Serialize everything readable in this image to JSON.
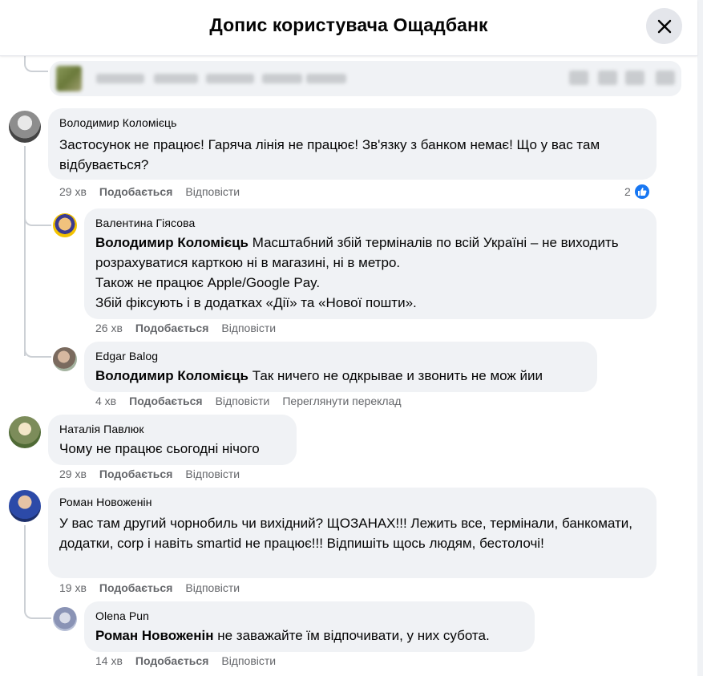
{
  "header": {
    "title": "Допис користувача Ощадбанк"
  },
  "comments": [
    {
      "author": "Володимир Коломієць",
      "text": "Застосунок не працює! Гаряча лінія не працює! Зв'язку з банком немає! Що у вас там відбувається?",
      "time": "29 хв",
      "like_label": "Подобається",
      "reply_label": "Відповісти",
      "reaction_count": "2"
    },
    {
      "author": "Валентина Гіясова",
      "mention": "Володимир Коломієць",
      "text": "Масштабний збій терміналів по всій Україні – не виходить розрахуватися карткою ні в магазині, ні в метро.",
      "line2": "Також не працює Apple/Google Pay.",
      "line3": "Збій фіксують і в додатках «Дії» та «Нової пошти».",
      "time": "26 хв",
      "like_label": "Подобається",
      "reply_label": "Відповісти"
    },
    {
      "author": "Edgar Balog",
      "mention": "Володимир Коломієць",
      "text": "Так ничего не одкрывае и звонить не мож йии",
      "time": "4 хв",
      "like_label": "Подобається",
      "reply_label": "Відповісти",
      "translate_label": "Переглянути переклад"
    },
    {
      "author": "Наталія Павлюк",
      "text": "Чому не працює сьогодні нічого",
      "time": "29 хв",
      "like_label": "Подобається",
      "reply_label": "Відповісти"
    },
    {
      "author": "Роман Новоженін",
      "text": "У вас там другий чорнобиль чи вихідний? ЩОЗАНАХ!!! Лежить все, термінали, банкомати, додатки, corp і навіть smartid не працює!!! Відпишіть щось людям, бестолочі!",
      "time": "19 хв",
      "like_label": "Подобається",
      "reply_label": "Відповісти"
    },
    {
      "author": "Olena Pun",
      "mention": "Роман Новоженін",
      "text": "не заважайте їм відпочивати, у них субота.",
      "time": "14 хв",
      "like_label": "Подобається",
      "reply_label": "Відповісти"
    }
  ],
  "colors": {
    "bubble": "#f0f2f5",
    "meta": "#65676b",
    "like_blue": "#1877f2"
  },
  "icons": {
    "close": "close-icon",
    "like": "like-icon"
  }
}
